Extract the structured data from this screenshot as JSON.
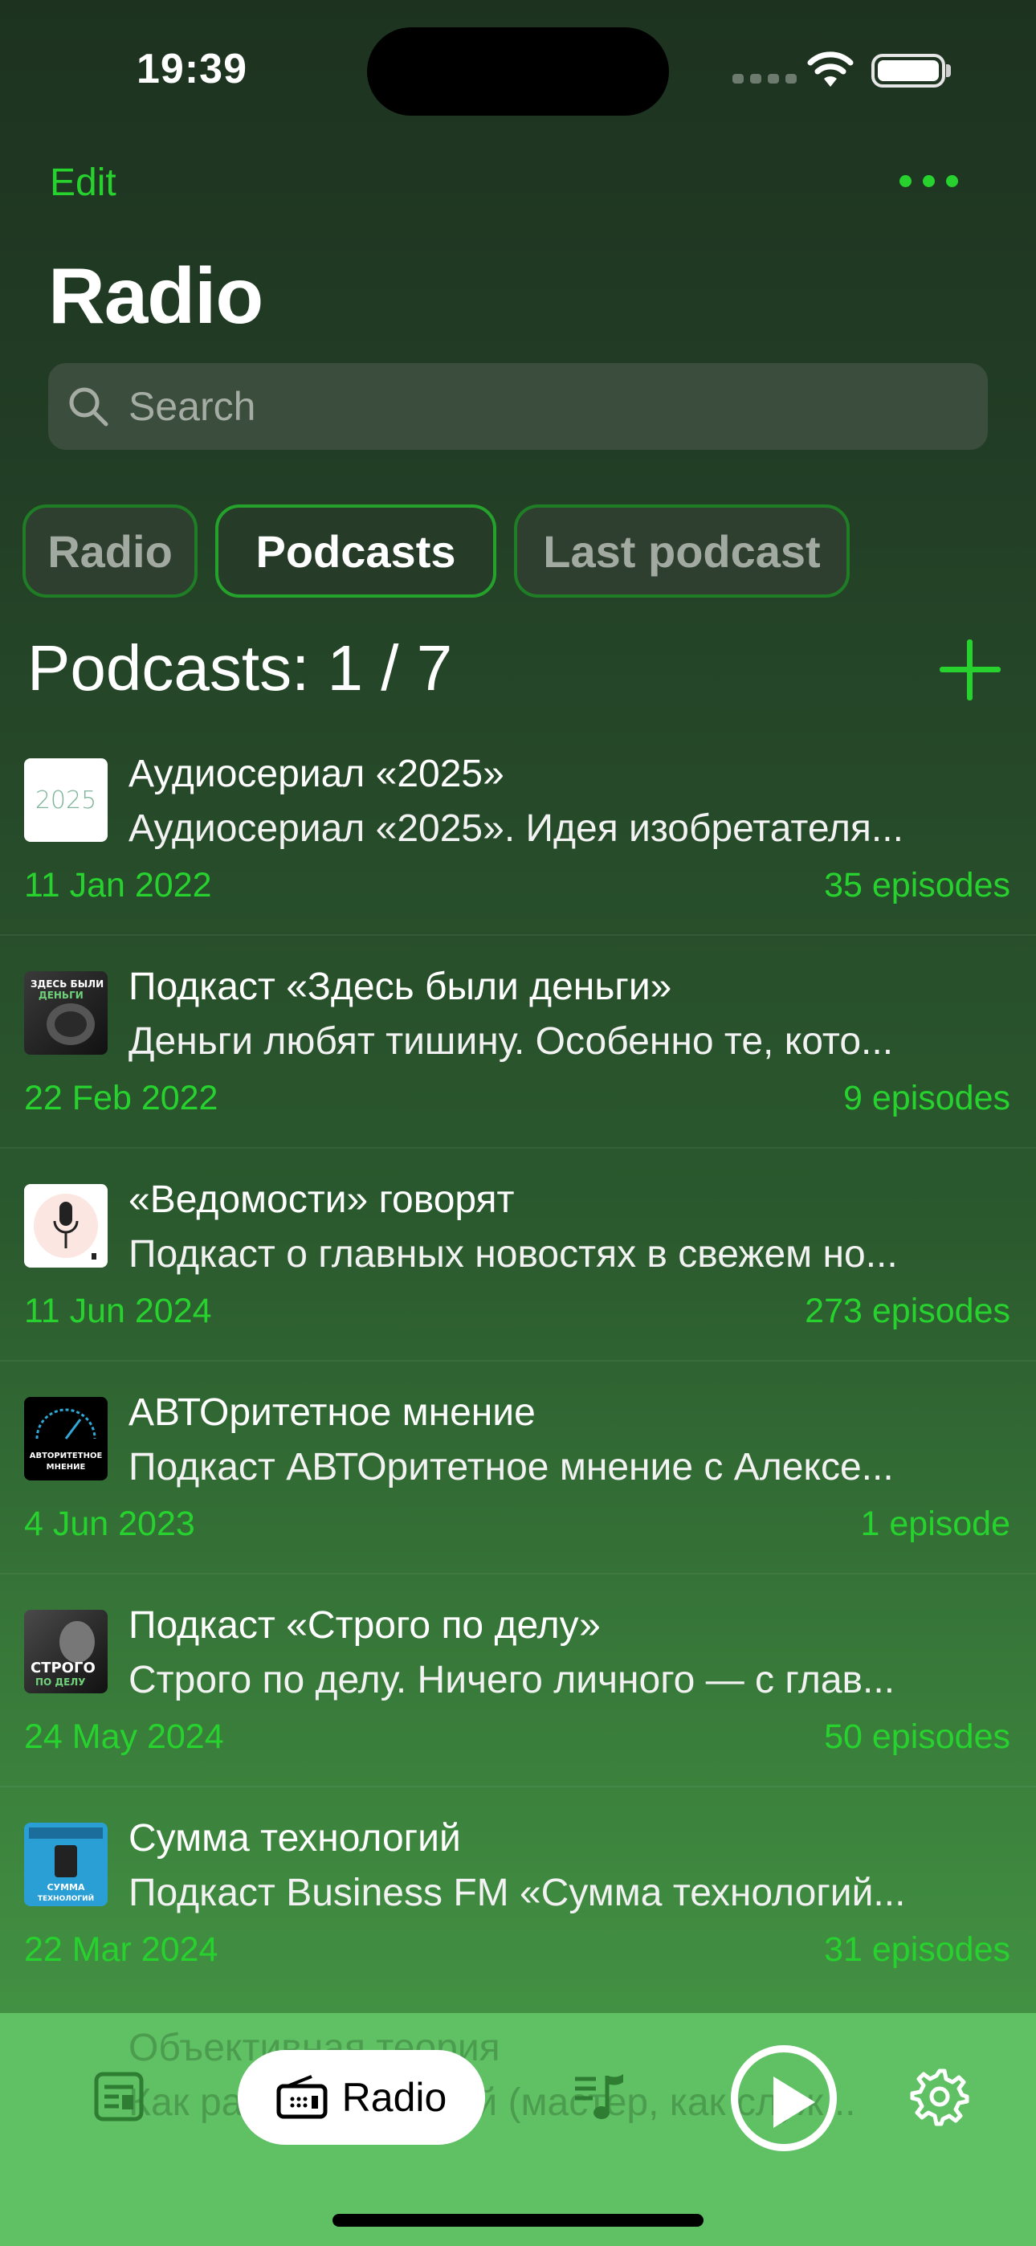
{
  "status": {
    "time": "19:39"
  },
  "nav": {
    "edit_label": "Edit",
    "title": "Radio"
  },
  "search": {
    "placeholder": "Search"
  },
  "segments": [
    {
      "label": "Radio",
      "active": false
    },
    {
      "label": "Podcasts",
      "active": true
    },
    {
      "label": "Last podcast",
      "active": false
    }
  ],
  "list_header": {
    "label": "Podcasts: 1 / 7"
  },
  "podcasts": [
    {
      "title": "Аудиосериал «2025»",
      "description": "Аудиосериал «2025». Идея изобретателя...",
      "date": "11 Jan 2022",
      "episodes": "35 episodes",
      "thumb_text": "2025"
    },
    {
      "title": "Подкаст «Здесь были деньги»",
      "description": "Деньги любят тишину. Особенно те, кото...",
      "date": "22 Feb 2022",
      "episodes": "9 episodes",
      "thumb_text": "ЗДЕСЬ БЫЛИ ДЕНЬГИ"
    },
    {
      "title": "«Ведомости» говорят",
      "description": "Подкаст о главных новостях в свежем но...",
      "date": "11 Jun 2024",
      "episodes": "273 episodes",
      "thumb_text": ""
    },
    {
      "title": "АВТОритетное мнение",
      "description": "Подкаст АВТОритетное мнение с Алексе...",
      "date": "4 Jun 2023",
      "episodes": "1 episode",
      "thumb_text": "АВТОРИТЕТНОЕ МНЕНИЕ"
    },
    {
      "title": "Подкаст «Строго по делу»",
      "description": "Строго по делу. Ничего личного — с глав...",
      "date": "24 May 2024",
      "episodes": "50 episodes",
      "thumb_text": "СТРОГО ПО ДЕЛУ"
    },
    {
      "title": "Сумма технологий",
      "description": "Подкаст Business FM «Сумма технологий...",
      "date": "22 Mar 2024",
      "episodes": "31 episodes",
      "thumb_text": "СУММА ТЕХНОЛОГИЙ"
    }
  ],
  "partial_row": {
    "title": "Объективная теория",
    "description": "Как работает теорий (мастер, как служ..."
  },
  "tabbar": {
    "active_label": "Radio"
  },
  "colors": {
    "accent": "#27d22f",
    "tabbar": "#5fc163"
  }
}
